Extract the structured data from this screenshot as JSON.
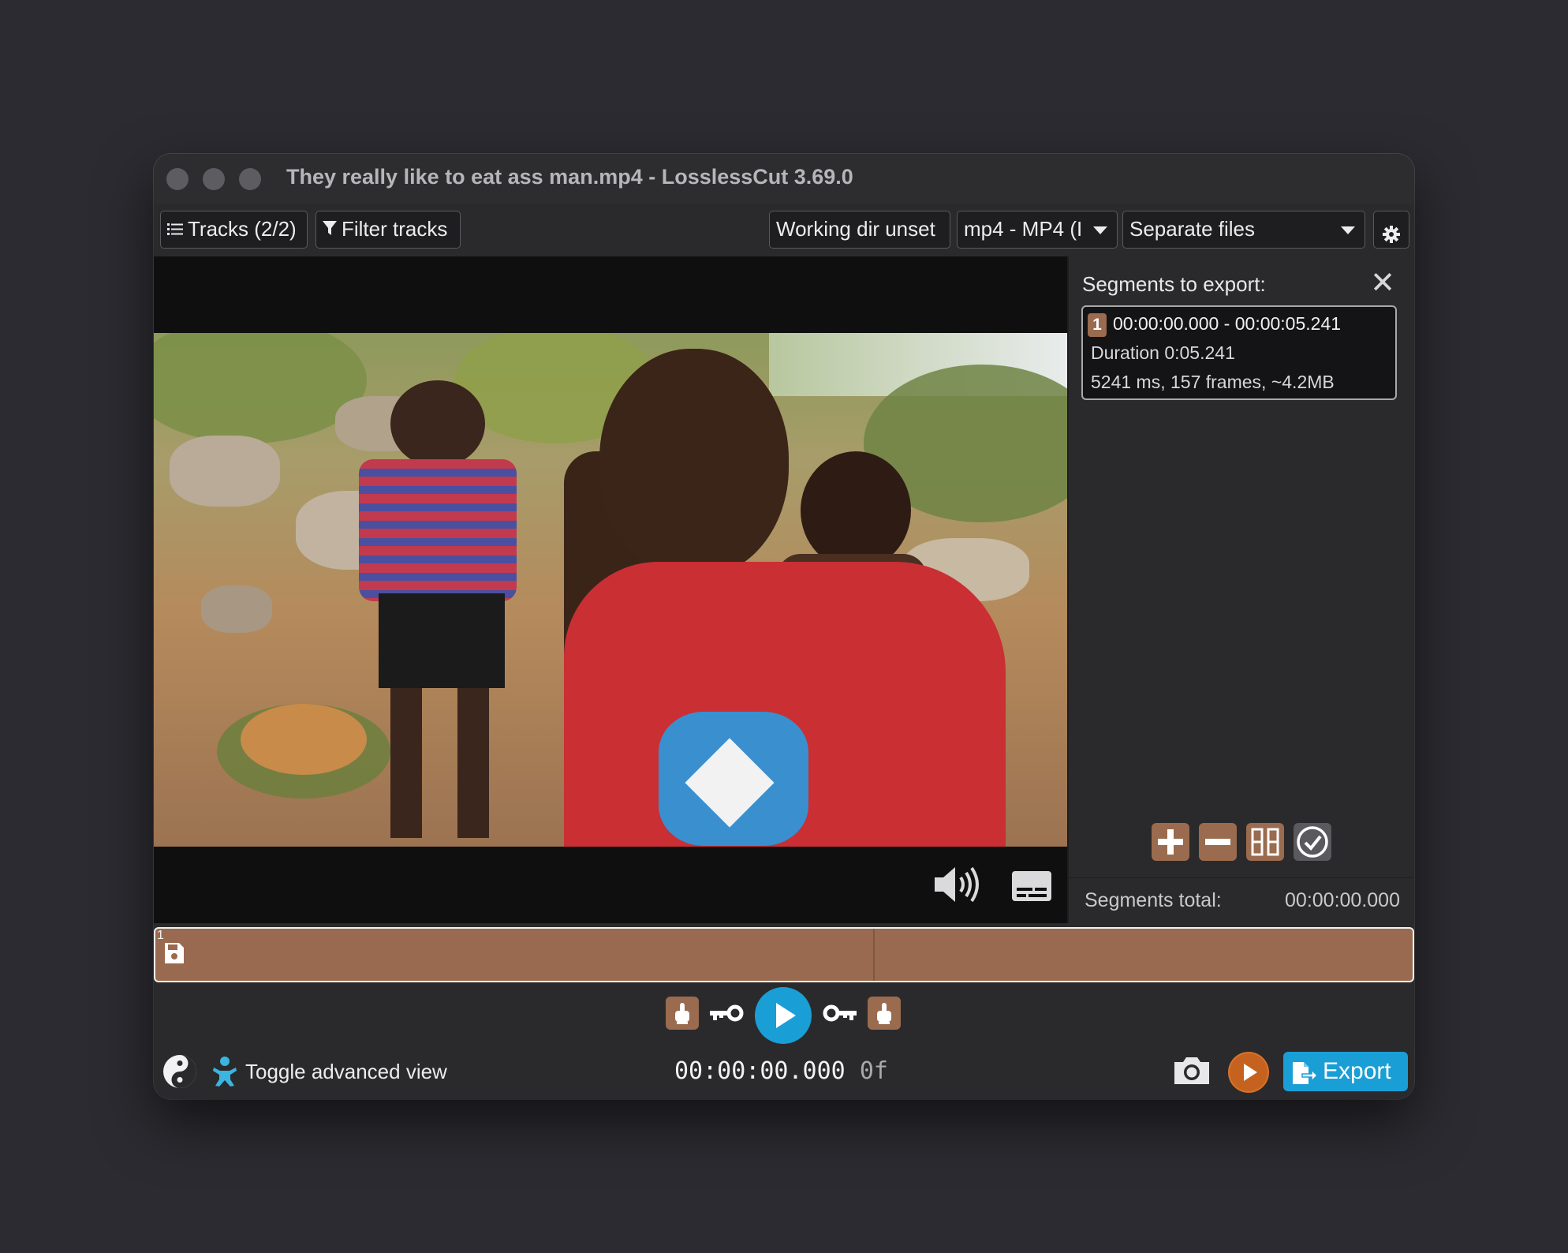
{
  "window": {
    "title": "They really like to eat ass man.mp4 - LosslessCut 3.69.0"
  },
  "toolbar": {
    "tracks_label": "Tracks (2/2)",
    "filter_label": "Filter tracks",
    "working_dir_label": "Working dir unset",
    "format_value": "mp4 - MP4 (I",
    "export_mode_value": "Separate files"
  },
  "segments_panel": {
    "title": "Segments to export:",
    "segments": [
      {
        "number": "1",
        "range": "00:00:00.000 - 00:00:05.241",
        "duration": "Duration 0:05.241",
        "details": "5241 ms, 157 frames, ~4.2MB",
        "color": "#9a6b4e"
      }
    ],
    "total_label": "Segments total:",
    "total_value": "00:00:00.000"
  },
  "timeline": {
    "segment_number": "1",
    "segment_color": "#996a4f"
  },
  "bottom": {
    "advanced_view_label": "Toggle advanced view",
    "timecode": "00:00:00.000",
    "frame": "0f",
    "export_label": "Export"
  },
  "colors": {
    "accent": "#1a9ed6",
    "segment": "#9a6b4e",
    "background": "#2a2a2c"
  },
  "icons": [
    "tracks-list-icon",
    "filter-icon",
    "settings-gear-icon",
    "close-icon",
    "volume-icon",
    "subtitles-icon",
    "add-segment-icon",
    "remove-segment-icon",
    "split-segment-icon",
    "check-icon",
    "save-icon",
    "set-start-icon",
    "keyframe-start-icon",
    "play-icon",
    "keyframe-end-icon",
    "set-end-icon",
    "theme-icon",
    "baby-icon",
    "camera-icon",
    "play-preview-icon",
    "export-icon"
  ]
}
